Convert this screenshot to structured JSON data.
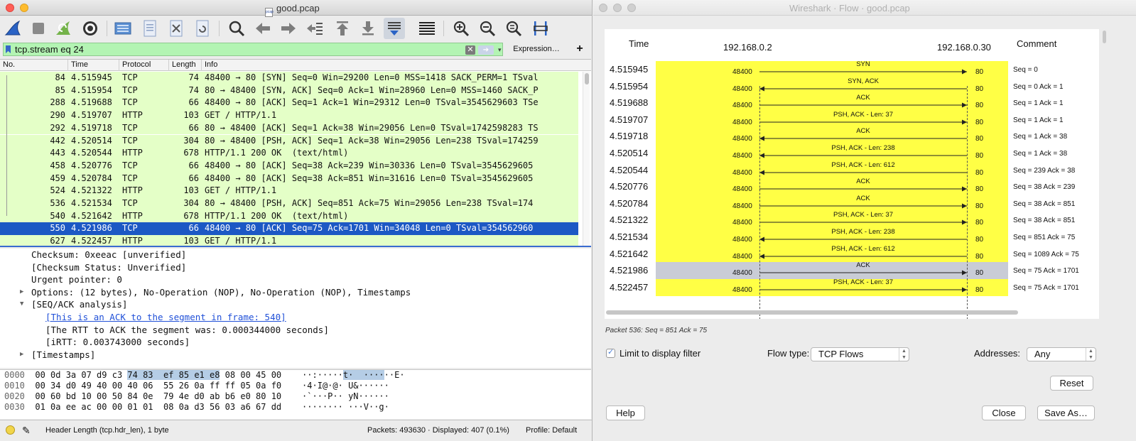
{
  "main_window": {
    "title": "good.pcap",
    "filter": {
      "value": "tcp.stream eq 24",
      "expression_label": "Expression…",
      "add_label": "+"
    },
    "packet_list": {
      "columns": [
        "No.",
        "Time",
        "Protocol",
        "Length",
        "Info"
      ],
      "rows": [
        {
          "no": "84",
          "time": "4.515945",
          "proto": "TCP",
          "len": "74",
          "info": "48400 → 80 [SYN] Seq=0 Win=29200 Len=0 MSS=1418 SACK_PERM=1 TSval"
        },
        {
          "no": "85",
          "time": "4.515954",
          "proto": "TCP",
          "len": "74",
          "info": "80 → 48400 [SYN, ACK] Seq=0 Ack=1 Win=28960 Len=0 MSS=1460 SACK_P"
        },
        {
          "no": "288",
          "time": "4.519688",
          "proto": "TCP",
          "len": "66",
          "info": "48400 → 80 [ACK] Seq=1 Ack=1 Win=29312 Len=0 TSval=3545629603 TSe"
        },
        {
          "no": "290",
          "time": "4.519707",
          "proto": "HTTP",
          "len": "103",
          "info": "GET / HTTP/1.1"
        },
        {
          "no": "292",
          "time": "4.519718",
          "proto": "TCP",
          "len": "66",
          "info": "80 → 48400 [ACK] Seq=1 Ack=38 Win=29056 Len=0 TSval=1742598283 TS"
        },
        {
          "no": "442",
          "time": "4.520514",
          "proto": "TCP",
          "len": "304",
          "info": "80 → 48400 [PSH, ACK] Seq=1 Ack=38 Win=29056 Len=238 TSval=174259"
        },
        {
          "no": "443",
          "time": "4.520544",
          "proto": "HTTP",
          "len": "678",
          "info": "HTTP/1.1 200 OK  (text/html)"
        },
        {
          "no": "458",
          "time": "4.520776",
          "proto": "TCP",
          "len": "66",
          "info": "48400 → 80 [ACK] Seq=38 Ack=239 Win=30336 Len=0 TSval=3545629605"
        },
        {
          "no": "459",
          "time": "4.520784",
          "proto": "TCP",
          "len": "66",
          "info": "48400 → 80 [ACK] Seq=38 Ack=851 Win=31616 Len=0 TSval=3545629605"
        },
        {
          "no": "524",
          "time": "4.521322",
          "proto": "HTTP",
          "len": "103",
          "info": "GET / HTTP/1.1"
        },
        {
          "no": "536",
          "time": "4.521534",
          "proto": "TCP",
          "len": "304",
          "info": "80 → 48400 [PSH, ACK] Seq=851 Ack=75 Win=29056 Len=238 TSval=174"
        },
        {
          "no": "540",
          "time": "4.521642",
          "proto": "HTTP",
          "len": "678",
          "info": "HTTP/1.1 200 OK  (text/html)"
        },
        {
          "no": "550",
          "time": "4.521986",
          "proto": "TCP",
          "len": "66",
          "info": "48400 → 80 [ACK] Seq=75 Ack=1701 Win=34048 Len=0 TSval=354562960",
          "selected": true
        },
        {
          "no": "627",
          "time": "4.522457",
          "proto": "HTTP",
          "len": "103",
          "info": "GET / HTTP/1.1"
        }
      ]
    },
    "details": [
      {
        "text": "Checksum: 0xeeac [unverified]",
        "indent": 0,
        "toggle": ""
      },
      {
        "text": "[Checksum Status: Unverified]",
        "indent": 0,
        "toggle": ""
      },
      {
        "text": "Urgent pointer: 0",
        "indent": 0,
        "toggle": ""
      },
      {
        "text": "Options: (12 bytes), No-Operation (NOP), No-Operation (NOP), Timestamps",
        "indent": 0,
        "toggle": "▶"
      },
      {
        "text": "[SEQ/ACK analysis]",
        "indent": 0,
        "toggle": "▼"
      },
      {
        "text": "[This is an ACK to the segment in frame: 540]",
        "indent": 1,
        "toggle": "",
        "link": true
      },
      {
        "text": "[The RTT to ACK the segment was: 0.000344000 seconds]",
        "indent": 1,
        "toggle": ""
      },
      {
        "text": "[iRTT: 0.003743000 seconds]",
        "indent": 1,
        "toggle": ""
      },
      {
        "text": "[Timestamps]",
        "indent": 0,
        "toggle": "▶"
      }
    ],
    "hex": [
      {
        "offset": "0000",
        "bytes_a": "00 0d 3a 07 d9 c3 ",
        "bytes_hl": "74 83  ef 85 e1 e8",
        "bytes_b": " 08 00 45 00",
        "ascii_a": "··:·····",
        "ascii_hl": "t·  ····",
        "ascii_b": "··E·"
      },
      {
        "offset": "0010",
        "bytes_a": "00 34 d0 49 40 00 40 06  55 26 0a ff ff 05 0a f0",
        "bytes_hl": "",
        "bytes_b": "",
        "ascii_a": "·4·I@·@· U&······",
        "ascii_hl": "",
        "ascii_b": ""
      },
      {
        "offset": "0020",
        "bytes_a": "00 60 bd 10 00 50 84 0e  79 4e d0 ab b6 e0 80 10",
        "bytes_hl": "",
        "bytes_b": "",
        "ascii_a": "·`···P·· yN······",
        "ascii_hl": "",
        "ascii_b": ""
      },
      {
        "offset": "0030",
        "bytes_a": "01 0a ee ac 00 00 01 01  08 0a d3 56 03 a6 67 dd",
        "bytes_hl": "",
        "bytes_b": "",
        "ascii_a": "········ ···V··g·",
        "ascii_hl": "",
        "ascii_b": ""
      }
    ],
    "status": {
      "field": "Header Length (tcp.hdr_len), 1 byte",
      "packets": "Packets: 493630 · Displayed: 407 (0.1%)",
      "profile": "Profile: Default"
    }
  },
  "flow_window": {
    "title": "Wireshark · Flow · good.pcap",
    "headers": {
      "time": "Time",
      "host_a": "192.168.0.2",
      "host_b": "192.168.0.30",
      "comment": "Comment"
    },
    "rows": [
      {
        "time": "4.515945",
        "left_port": "48400",
        "right_port": "80",
        "label": "SYN",
        "dir": "right",
        "comment": "Seq = 0"
      },
      {
        "time": "4.515954",
        "left_port": "48400",
        "right_port": "80",
        "label": "SYN, ACK",
        "dir": "left",
        "comment": "Seq = 0 Ack = 1"
      },
      {
        "time": "4.519688",
        "left_port": "48400",
        "right_port": "80",
        "label": "ACK",
        "dir": "right",
        "comment": "Seq = 1 Ack = 1"
      },
      {
        "time": "4.519707",
        "left_port": "48400",
        "right_port": "80",
        "label": "PSH, ACK - Len: 37",
        "dir": "right",
        "comment": "Seq = 1 Ack = 1"
      },
      {
        "time": "4.519718",
        "left_port": "48400",
        "right_port": "80",
        "label": "ACK",
        "dir": "left",
        "comment": "Seq = 1 Ack = 38"
      },
      {
        "time": "4.520514",
        "left_port": "48400",
        "right_port": "80",
        "label": "PSH, ACK - Len: 238",
        "dir": "left",
        "comment": "Seq = 1 Ack = 38"
      },
      {
        "time": "4.520544",
        "left_port": "48400",
        "right_port": "80",
        "label": "PSH, ACK - Len: 612",
        "dir": "left",
        "comment": "Seq = 239 Ack = 38"
      },
      {
        "time": "4.520776",
        "left_port": "48400",
        "right_port": "80",
        "label": "ACK",
        "dir": "right",
        "comment": "Seq = 38 Ack = 239"
      },
      {
        "time": "4.520784",
        "left_port": "48400",
        "right_port": "80",
        "label": "ACK",
        "dir": "right",
        "comment": "Seq = 38 Ack = 851"
      },
      {
        "time": "4.521322",
        "left_port": "48400",
        "right_port": "80",
        "label": "PSH, ACK - Len: 37",
        "dir": "right",
        "comment": "Seq = 38 Ack = 851"
      },
      {
        "time": "4.521534",
        "left_port": "48400",
        "right_port": "80",
        "label": "PSH, ACK - Len: 238",
        "dir": "left",
        "comment": "Seq = 851 Ack = 75"
      },
      {
        "time": "4.521642",
        "left_port": "48400",
        "right_port": "80",
        "label": "PSH, ACK - Len: 612",
        "dir": "left",
        "comment": "Seq = 1089 Ack = 75"
      },
      {
        "time": "4.521986",
        "left_port": "48400",
        "right_port": "80",
        "label": "ACK",
        "dir": "right",
        "comment": "Seq = 75 Ack = 1701",
        "selected": true
      },
      {
        "time": "4.522457",
        "left_port": "48400",
        "right_port": "80",
        "label": "PSH, ACK - Len: 37",
        "dir": "right",
        "comment": "Seq = 75 Ack = 1701"
      }
    ],
    "packet_info": "Packet 536: Seq = 851 Ack = 75",
    "limit_label": "Limit to display filter",
    "flow_type_label": "Flow type:",
    "flow_type_value": "TCP Flows",
    "addresses_label": "Addresses:",
    "addresses_value": "Any",
    "reset_label": "Reset",
    "help_label": "Help",
    "close_label": "Close",
    "save_label": "Save As…"
  },
  "colors": {
    "filter_ok": "#b3f4b3",
    "row_bg": "#e4ffc7",
    "selected": "#1c58c4",
    "flow_band": "#ffff45"
  }
}
